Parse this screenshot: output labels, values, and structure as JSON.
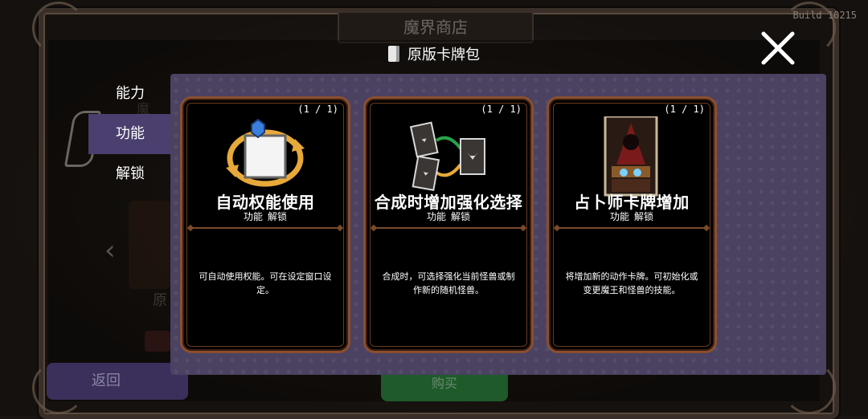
{
  "background": {
    "shop_title": "魔界商店",
    "build": "Build 10215",
    "back_label": "返回",
    "buy_label": "购买",
    "bg_text_yuan": "原",
    "bg_text_mo": "魔"
  },
  "tabs": [
    {
      "label": "能力",
      "active": false
    },
    {
      "label": "功能",
      "active": true
    },
    {
      "label": "解锁",
      "active": false
    }
  ],
  "modal": {
    "title": "原版卡牌包",
    "close_icon": "close-icon",
    "panel_color": "#4b4262"
  },
  "cards": [
    {
      "count": "(1 / 1)",
      "name": "自动权能使用",
      "tag1": "功能",
      "tag2": "解锁",
      "description": "可自动使用权能。可在设定窗口设定。",
      "icon": "auto-cycle-icon"
    },
    {
      "count": "(1 / 1)",
      "name": "合成时增加强化选择",
      "tag1": "功能",
      "tag2": "解锁",
      "description": "合成时，可选择强化当前怪兽或制作新的随机怪兽。",
      "icon": "card-merge-icon"
    },
    {
      "count": "(1 / 1)",
      "name": "占卜师卡牌增加",
      "tag1": "功能",
      "tag2": "解锁",
      "description": "将增加新的动作卡牌。可初始化或变更魔王和怪兽的技能。",
      "icon": "fortune-teller-card-icon"
    }
  ],
  "colors": {
    "card_border": "#8a4f2f",
    "tab_active": "#4a3f6e",
    "back_button": "#3b2f5c",
    "buy_button": "#1e5a2a"
  }
}
